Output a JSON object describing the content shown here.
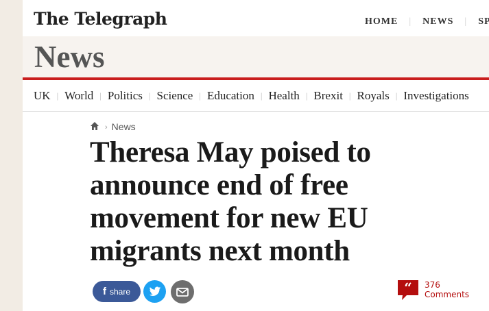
{
  "header": {
    "logo": "The Telegraph",
    "nav": [
      {
        "label": "HOME"
      },
      {
        "label": "NEWS"
      },
      {
        "label": "SPO"
      }
    ]
  },
  "section": {
    "title": "News"
  },
  "subnav": {
    "items": [
      {
        "label": "UK"
      },
      {
        "label": "World"
      },
      {
        "label": "Politics"
      },
      {
        "label": "Science"
      },
      {
        "label": "Education"
      },
      {
        "label": "Health"
      },
      {
        "label": "Brexit"
      },
      {
        "label": "Royals"
      },
      {
        "label": "Investigations"
      }
    ]
  },
  "breadcrumb": {
    "home_icon": "home-icon",
    "label": "News"
  },
  "article": {
    "headline": "Theresa May poised to announce end of free movement for new EU migrants next month"
  },
  "share": {
    "facebook_label": "share",
    "facebook_color": "#3b5998",
    "twitter_color": "#1da1f2",
    "email_color": "#6e6e6e"
  },
  "comments": {
    "count": "376",
    "label": "Comments",
    "color": "#b40e0e"
  },
  "colors": {
    "accent": "#c91d1d",
    "section_band": "#f7f3ef",
    "side_background": "#f2ece4"
  }
}
